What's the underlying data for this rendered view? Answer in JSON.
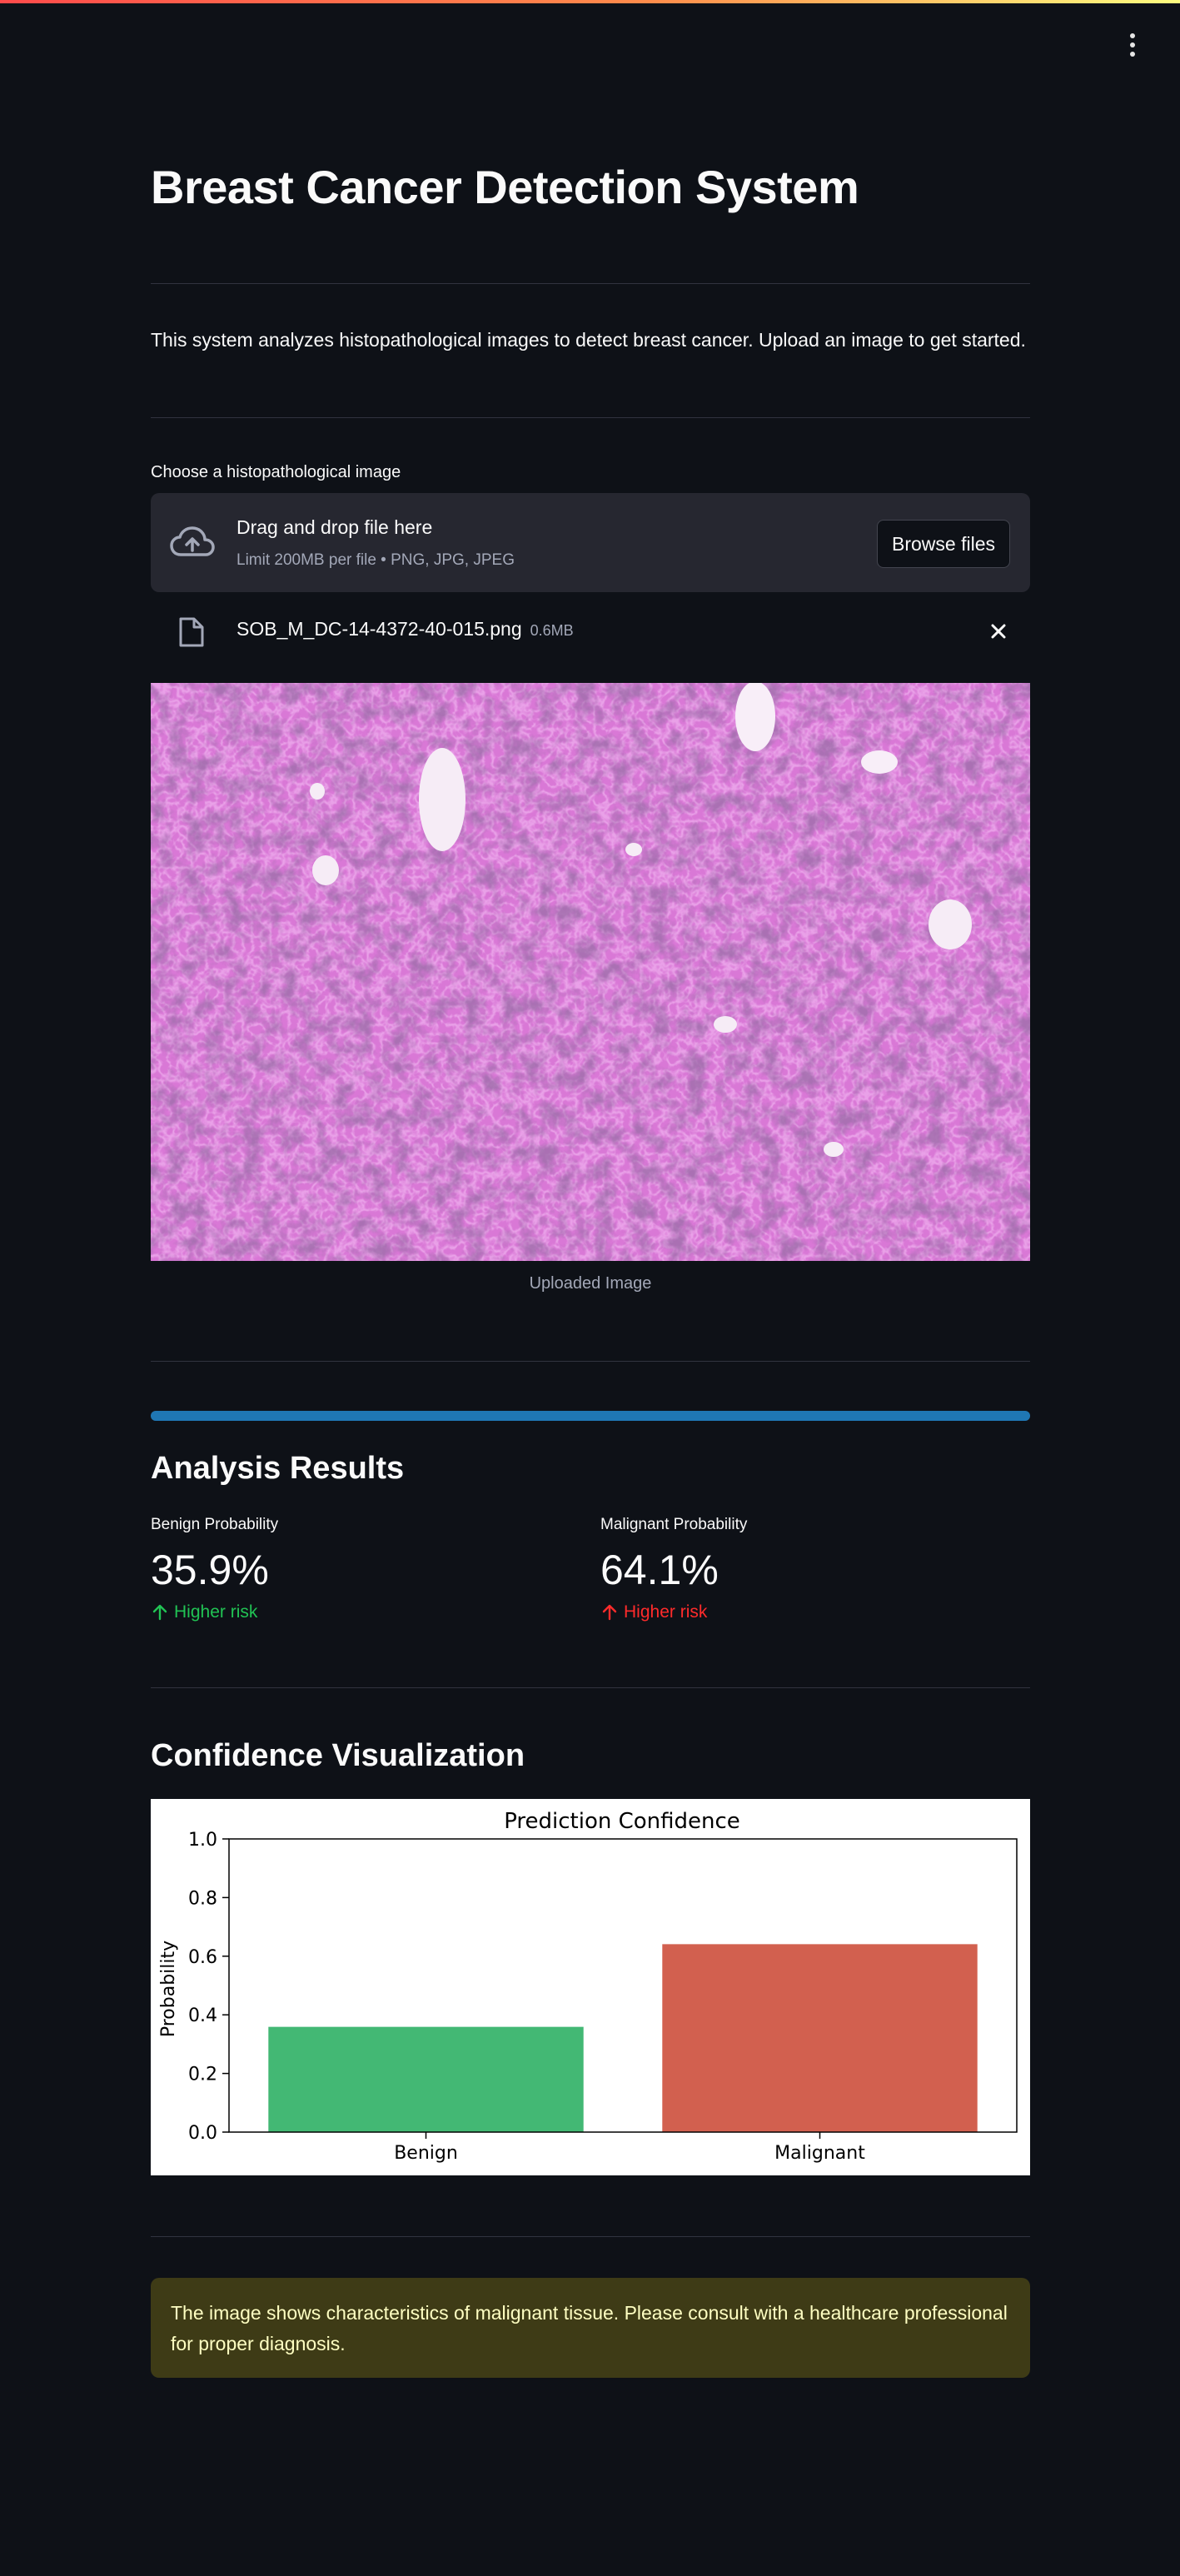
{
  "header": {
    "menu_icon": "kebab-menu-icon"
  },
  "page": {
    "title": "Breast Cancer Detection System",
    "intro": "This system analyzes histopathological images to detect breast cancer. Upload an image to get started."
  },
  "uploader": {
    "label": "Choose a histopathological image",
    "dropzone_title": "Drag and drop file here",
    "dropzone_subtitle": "Limit 200MB per file • PNG, JPG, JPEG",
    "browse_label": "Browse files",
    "file": {
      "name": "SOB_M_DC-14-4372-40-015.png",
      "size": "0.6MB"
    }
  },
  "image": {
    "caption": "Uploaded Image"
  },
  "progress": {
    "value": 1.0
  },
  "results": {
    "heading": "Analysis Results",
    "benign": {
      "label": "Benign Probability",
      "value": "35.9%",
      "delta": "Higher risk",
      "delta_color": "#21c354"
    },
    "malignant": {
      "label": "Malignant Probability",
      "value": "64.1%",
      "delta": "Higher risk",
      "delta_color": "#ff2b2b"
    }
  },
  "visualization": {
    "heading": "Confidence Visualization"
  },
  "chart_data": {
    "type": "bar",
    "title": "Prediction Confidence",
    "categories": [
      "Benign",
      "Malignant"
    ],
    "values": [
      0.359,
      0.641
    ],
    "colors": [
      "#43b874",
      "#d2604f"
    ],
    "xlabel": "",
    "ylabel": "Probability",
    "ylim": [
      0,
      1.0
    ],
    "yticks": [
      "0.0",
      "0.2",
      "0.4",
      "0.6",
      "0.8",
      "1.0"
    ],
    "grid": false
  },
  "alert": {
    "text": "The image shows characteristics of malignant tissue. Please consult with a healthcare professional for proper diagnosis."
  },
  "colors": {
    "background": "#0e1117",
    "progress": "#1f77b4",
    "alert_bg": "#3e3b16",
    "alert_text": "#ffffc2"
  }
}
